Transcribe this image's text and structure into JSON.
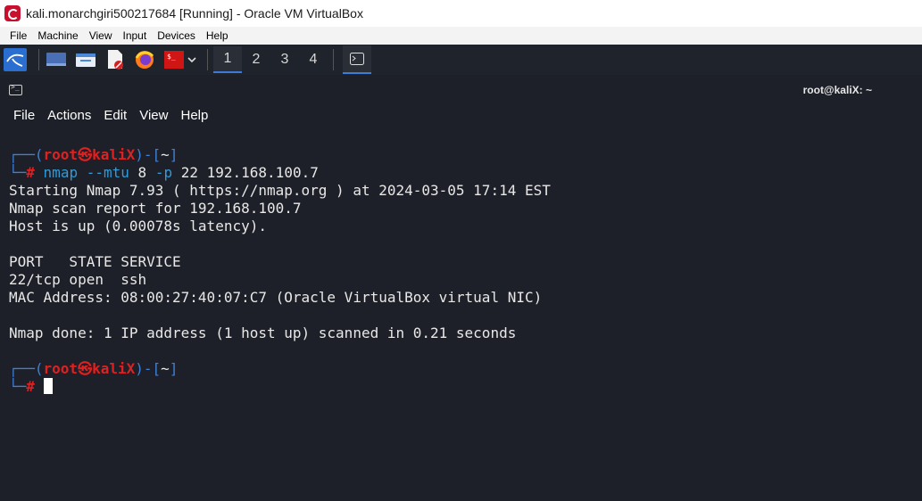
{
  "window": {
    "title": "kali.monarchgiri500217684 [Running] - Oracle VM VirtualBox"
  },
  "vbox_menu": [
    "File",
    "Machine",
    "View",
    "Input",
    "Devices",
    "Help"
  ],
  "panel": {
    "workspaces": [
      "1",
      "2",
      "3",
      "4"
    ],
    "active_workspace": "1",
    "app_icons": [
      "kali-menu-icon",
      "desktop-icon",
      "file-manager-icon",
      "text-editor-icon",
      "firefox-icon",
      "terminal-icon",
      "chevron-down-icon",
      "terminal-window-icon"
    ]
  },
  "terminal": {
    "title": "root@kaliX: ~",
    "menu": [
      "File",
      "Actions",
      "Edit",
      "View",
      "Help"
    ],
    "prompt": {
      "corner_top": "┌──(",
      "user": "root",
      "at": "㉿",
      "host": "kaliX",
      "mid": ")-[",
      "path": "~",
      "end": "]",
      "corner_bottom": "└─",
      "symbol": "#"
    },
    "command": {
      "bin": "nmap",
      "opt1": "--mtu",
      "arg1": "8",
      "opt2": "-p",
      "arg2": "22 192.168.100.7"
    },
    "output": [
      "Starting Nmap 7.93 ( https://nmap.org ) at 2024-03-05 17:14 EST",
      "Nmap scan report for 192.168.100.7",
      "Host is up (0.00078s latency).",
      "",
      "PORT   STATE SERVICE",
      "22/tcp open  ssh",
      "MAC Address: 08:00:27:40:07:C7 (Oracle VirtualBox virtual NIC)",
      "",
      "Nmap done: 1 IP address (1 host up) scanned in 0.21 seconds"
    ]
  },
  "colors": {
    "terminal_bg": "#1d2028",
    "prompt_blue": "#3f7fd6",
    "prompt_red": "#e02020",
    "command_cyan": "#2f9bd8"
  }
}
